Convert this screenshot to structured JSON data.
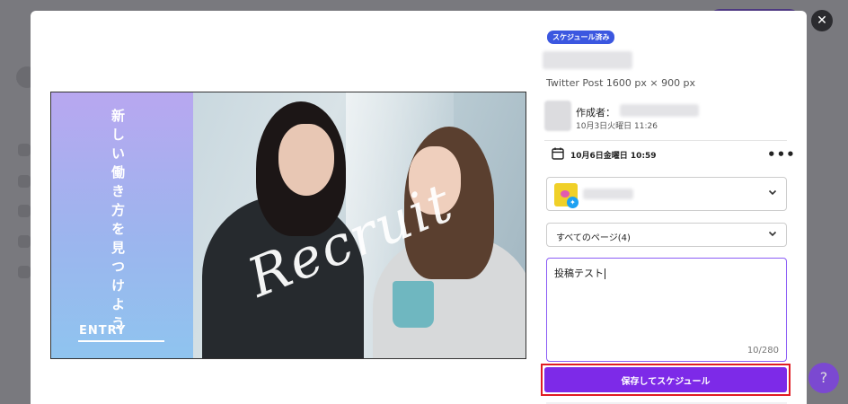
{
  "status_badge": "スケジュール済み",
  "design": {
    "format": "Twitter Post 1600 px × 900 px"
  },
  "creator": {
    "label": "作成者：",
    "created_at": "10月3日火曜日 11:26"
  },
  "schedule": {
    "datetime": "10月6日金曜日 10:59",
    "more_label": "•••"
  },
  "page_select": {
    "value": "すべてのページ(4)"
  },
  "caption": {
    "text": "投稿テスト",
    "count": "10/280"
  },
  "save_button": "保存してスケジュール",
  "preview": {
    "vertical_text": "新しい働き方を見つけよう",
    "entry": "ENTRY",
    "script": "Recruit"
  },
  "icons": {
    "close": "close-icon",
    "calendar": "calendar-icon",
    "chevron": "chevron-down-icon"
  },
  "colors": {
    "accent": "#7d2ae8",
    "badge": "#3b57e0",
    "highlight": "#e01b24"
  }
}
